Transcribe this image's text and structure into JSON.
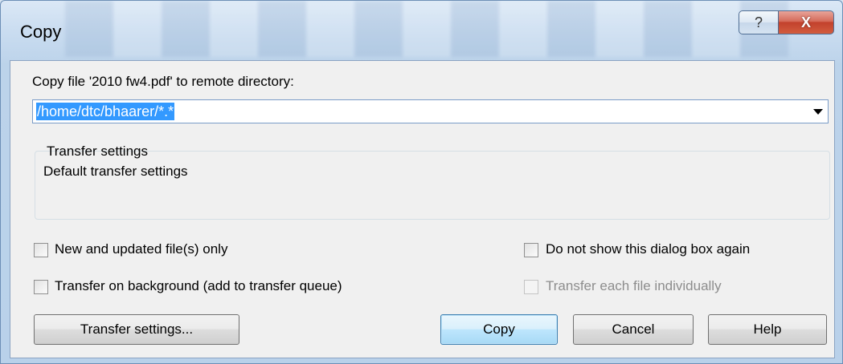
{
  "window": {
    "title": "Copy",
    "help_glyph": "?",
    "close_glyph": "X"
  },
  "dialog": {
    "prompt_label": "Copy file '2010 fw4.pdf' to remote directory:",
    "directory_value": "/home/dtc/bhaarer/*.*",
    "transfer_group_title": "Transfer settings",
    "transfer_group_value": "Default transfer settings"
  },
  "options": {
    "new_updated_only": {
      "label": "New and updated file(s) only",
      "checked": false
    },
    "transfer_background": {
      "label": "Transfer on background (add to transfer queue)",
      "checked": false
    },
    "do_not_show": {
      "label": "Do not show this dialog box again",
      "checked": false
    },
    "each_individually": {
      "label": "Transfer each file individually",
      "checked": false,
      "enabled": false
    }
  },
  "buttons": {
    "transfer_settings": "Transfer settings...",
    "copy": "Copy",
    "cancel": "Cancel",
    "help": "Help"
  },
  "icons": {
    "help": "question-icon",
    "close": "close-icon",
    "dropdown": "chevron-down-icon"
  }
}
